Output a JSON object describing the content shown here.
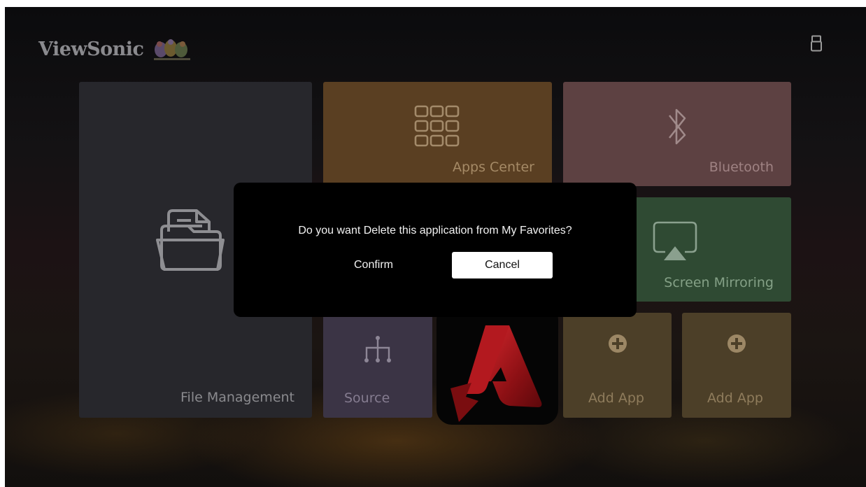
{
  "brand": {
    "logo_text": "ViewSonic"
  },
  "tiles": {
    "file_management": "File Management",
    "apps_center": "Apps Center",
    "bluetooth": "Bluetooth",
    "screen_mirroring": "Screen Mirroring",
    "source": "Source",
    "add_app_1": "Add App",
    "add_app_2": "Add App"
  },
  "dialog": {
    "message": "Do you want Delete this application from My Favorites?",
    "confirm_label": "Confirm",
    "cancel_label": "Cancel",
    "focused_button": "Cancel"
  },
  "colors": {
    "file_tile": "#27272c",
    "apps_tile": "#5a3f22",
    "bluetooth_tile": "#5d4142",
    "mirroring_tile": "#2f4a33",
    "source_tile": "#3b3445",
    "add_app_tile": "#4c3f28",
    "dialog_bg": "#000000",
    "adobe_red": "#c4161c"
  },
  "icons": {
    "status_bar": "usb-icon",
    "file_management": "folder-documents-icon",
    "apps_center": "grid-icon",
    "bluetooth": "bluetooth-icon",
    "screen_mirroring": "airplay-icon",
    "source": "source-input-icon",
    "add_app": "plus-circle-icon",
    "favorite_app": "adobe-acrobat-icon"
  }
}
